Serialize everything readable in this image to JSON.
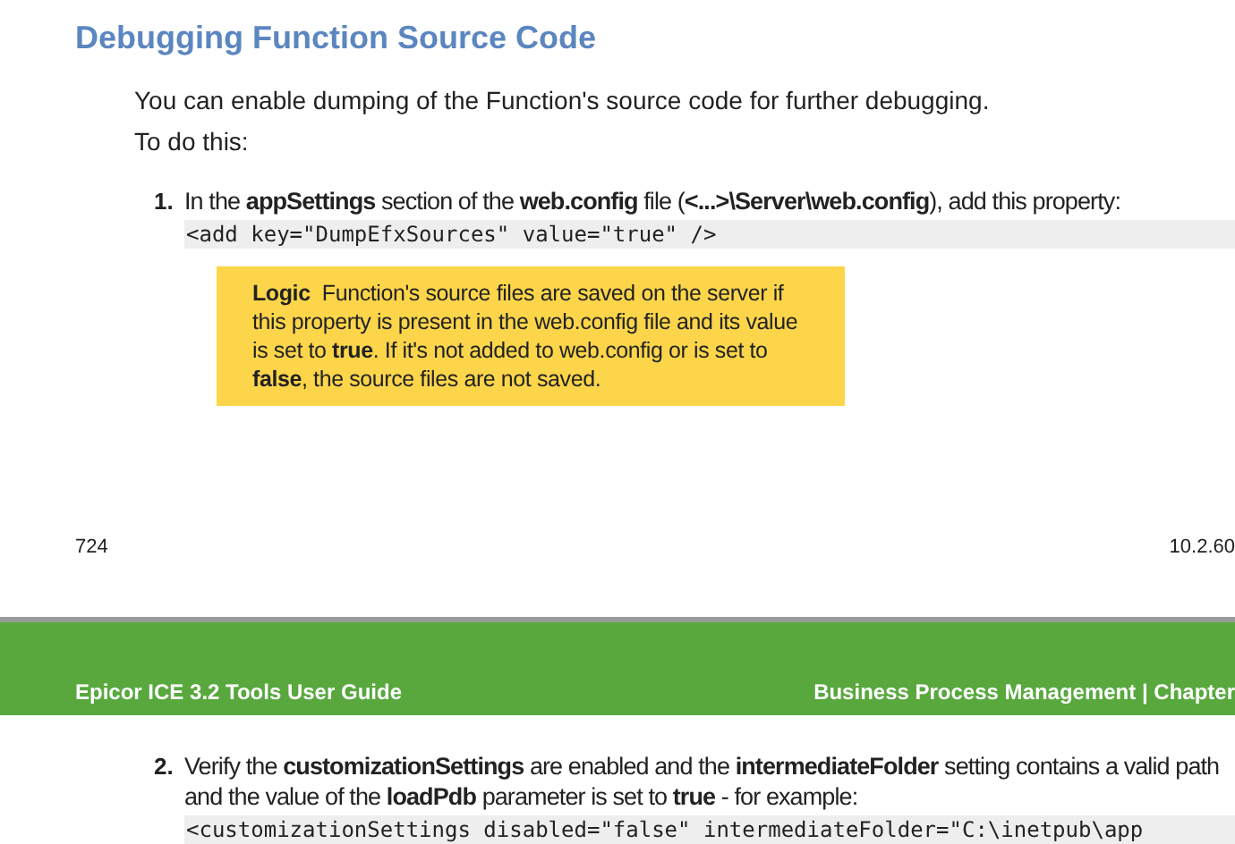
{
  "heading": "Debugging Function Source Code",
  "intro": [
    "You can enable dumping of the Function's source code for further debugging.",
    "To do this:"
  ],
  "steps": [
    {
      "number": "1.",
      "lines": [
        "In the **appSettings** section of the **web.config** file (**<...>\\Server\\web.config**), add this property:"
      ],
      "code": "<add key=\"DumpEfxSources\" value=\"true\" />",
      "note": {
        "label": "Logic",
        "text": "Function's source files are saved on the server if this property is present in the web.config file and its value is set to **true**. If it's not added to web.config or is set to **false**, the source files are not saved."
      }
    }
  ],
  "page_footer": {
    "page_number": "724",
    "version": "10.2.60"
  },
  "page_header": {
    "left": "Epicor ICE 3.2 Tools User Guide",
    "right": "Business Process Management | Chapter"
  },
  "next_steps": [
    {
      "number": "2.",
      "lines": [
        "Verify the **customizationSettings** are enabled and the **intermediateFolder** setting contains a valid path",
        "and the value of the **loadPdb** parameter is set to **true** - for example:"
      ],
      "code": "<customizationSettings disabled=\"false\" intermediateFolder=\"C:\\inetpub\\app"
    }
  ]
}
